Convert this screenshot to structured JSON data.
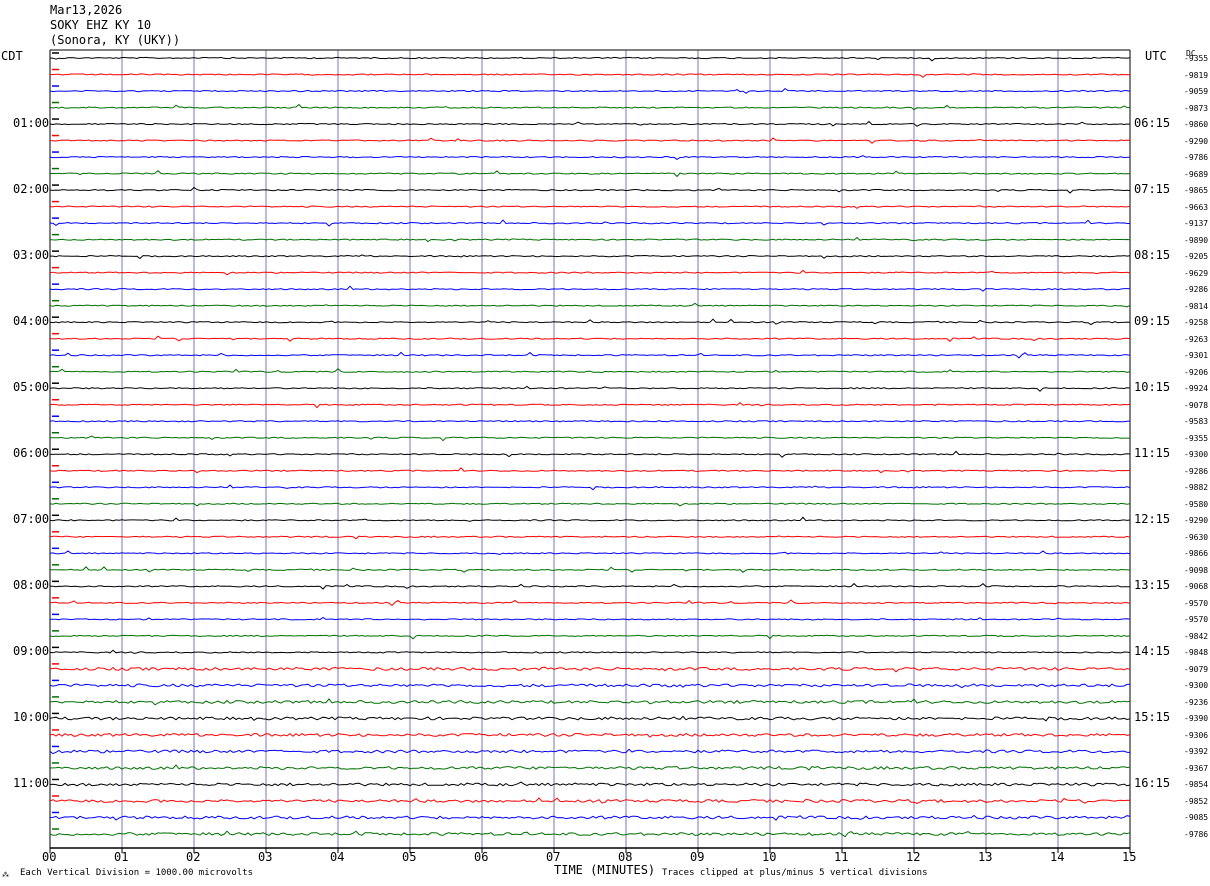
{
  "header": {
    "date": "Mar13,2026",
    "station": "SOKY EHZ KY 10",
    "location": "(Sonora, KY (UKY))"
  },
  "left_label": "CDT",
  "right_label": "UTC",
  "dc_label": "DC",
  "footer": {
    "scale_note": "Each Vertical Division = 1000.00 microvolts",
    "clip_note": "Traces clipped at plus/minus 5 vertical divisions",
    "x_axis_label": "TIME (MINUTES)"
  },
  "colors": {
    "traces": [
      "#000000",
      "#ff0000",
      "#0000ff",
      "#007000"
    ],
    "grid": "#7a7ab4"
  },
  "chart_data": {
    "type": "line",
    "title": "SOKY EHZ KY 10",
    "xlabel": "TIME (MINUTES)",
    "xlim": [
      0,
      15
    ],
    "x_ticks": [
      "00",
      "01",
      "02",
      "03",
      "04",
      "05",
      "06",
      "07",
      "08",
      "09",
      "10",
      "11",
      "12",
      "13",
      "14",
      "15"
    ],
    "rows": 48,
    "minutes_per_row": 15,
    "cdt_hour_labels": [
      "01:00",
      "02:00",
      "03:00",
      "04:00",
      "05:00",
      "06:00",
      "07:00",
      "08:00",
      "09:00",
      "10:00",
      "11:00"
    ],
    "utc_hour_labels": [
      "06:15",
      "07:15",
      "08:15",
      "09:15",
      "10:15",
      "11:15",
      "12:15",
      "13:15",
      "14:15",
      "15:15",
      "16:15"
    ],
    "dc_offsets": [
      "-9355",
      "-9819",
      "-9059",
      "-9873",
      "-9860",
      "-9290",
      "-9786",
      "-9689",
      "-9865",
      "-9663",
      "-9137",
      "-9890",
      "-9205",
      "-9629",
      "-9286",
      "-9814",
      "-9258",
      "-9263",
      "-9301",
      "-9206",
      "-9924",
      "-9078",
      "-9583",
      "-9355",
      "-9300",
      "-9286",
      "-9882",
      "-9580",
      "-9290",
      "-9630",
      "-9866",
      "-9098",
      "-9068",
      "-9570",
      "-9570",
      "-9842",
      "-9848",
      "-9079",
      "-9300",
      "-9236",
      "-9390",
      "-9306",
      "-9392",
      "-9367",
      "-9854",
      "-9852",
      "-9085",
      "-9786"
    ]
  }
}
